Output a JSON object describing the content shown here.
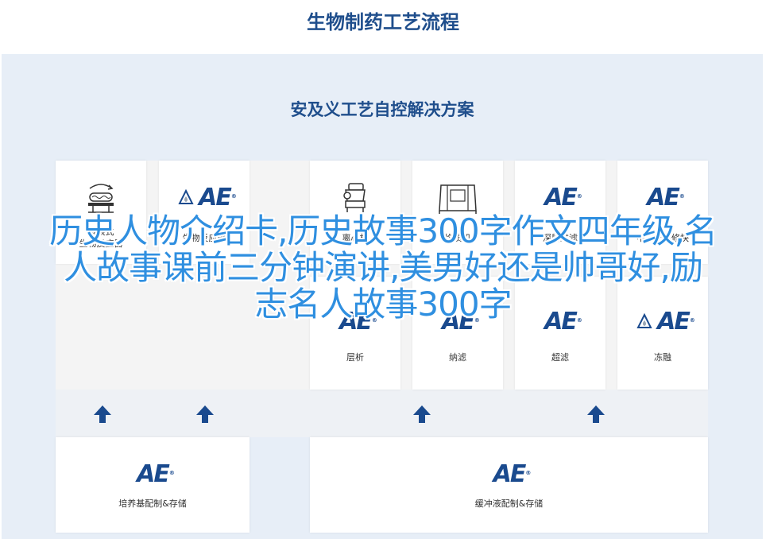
{
  "header": {
    "title": "生物制药工艺流程"
  },
  "panel": {
    "title": "安及义工艺自控解决方案"
  },
  "brand": {
    "logo_text": "AE",
    "logo_sup": "®",
    "accent": "#1a4a8e",
    "overlay_color": "#2f8fe0"
  },
  "process_cards": [
    {
      "label": "波浪式\n生物反应器",
      "icon": "wave-bioreactor-icon"
    },
    {
      "label": "生物反应器",
      "icon": "ae-logo"
    },
    {
      "label": "离心机",
      "icon": "centrifuge-icon"
    },
    {
      "label": "均质机",
      "icon": "homogenizer-icon"
    },
    {
      "label": "深层过滤",
      "icon": "ae-logo"
    },
    {
      "label": "中间产品修快",
      "icon": "ae-logo"
    },
    {
      "label": "层析",
      "icon": "ae-logo"
    },
    {
      "label": "纳滤",
      "icon": "ae-logo"
    },
    {
      "label": "超滤",
      "icon": "ae-logo"
    },
    {
      "label": "冻融",
      "icon": "ae-logo"
    }
  ],
  "prep_cards": [
    {
      "label": "培养基配制&存储",
      "icon": "ae-logo"
    },
    {
      "label": "缓冲液配制&存储",
      "icon": "ae-logo"
    }
  ],
  "overlay_text": "历史人物介绍卡,历史故事300字作文四年级,名人故事课前三分钟演讲,美男好还是帅哥好,励志名人故事300字"
}
